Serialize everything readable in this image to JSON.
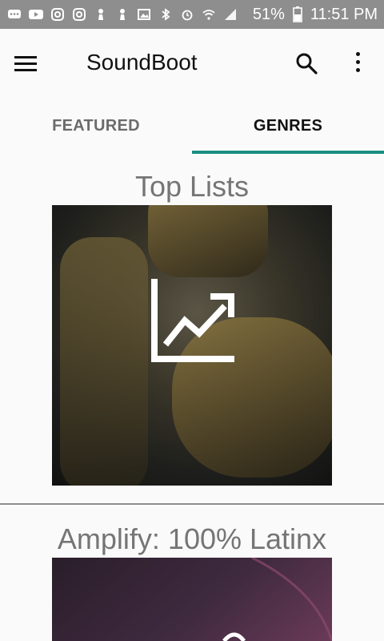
{
  "status_bar": {
    "battery": "51%",
    "time": "11:51 PM",
    "icons": [
      "chat-icon",
      "youtube-icon",
      "instagram-icon",
      "instagram-icon",
      "pawn-icon",
      "pawn-icon",
      "image-icon",
      "bluetooth-icon",
      "alarm-icon",
      "wifi-icon",
      "signal-icon",
      "battery-icon"
    ]
  },
  "app_bar": {
    "title": "SoundBoot"
  },
  "tabs": [
    {
      "label": "FEATURED",
      "selected": false
    },
    {
      "label": "GENRES",
      "selected": true
    }
  ],
  "sections": [
    {
      "title": "Top Lists",
      "icon": "trending-up-icon"
    },
    {
      "title": "Amplify: 100% Latinx",
      "icon": ""
    }
  ],
  "colors": {
    "accent": "#1a8f82",
    "status_bar": "#8e8e8e"
  }
}
